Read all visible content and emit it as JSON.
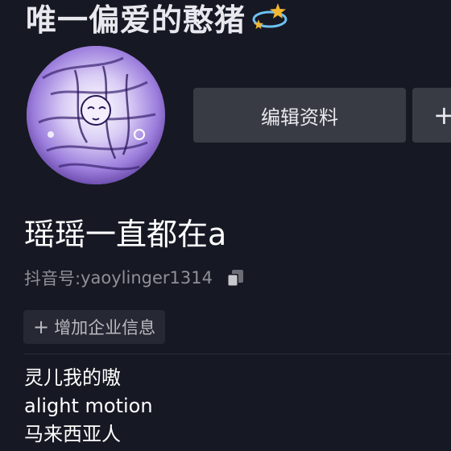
{
  "profile": {
    "top_name": "唯一偏爱的憨猪",
    "top_name_emoji": "sparkle-emoji",
    "nickname": "瑶瑶一直都在a",
    "douyin_id_label": "抖音号:",
    "douyin_id": "yaoylinger1314",
    "bio_lines": [
      "灵儿我的嗷",
      "alight motion",
      "马来西亚人"
    ]
  },
  "actions": {
    "edit_profile_label": "编辑资料",
    "add_friend_label": "+"
  },
  "business": {
    "add_info_label": "增加企业信息",
    "add_icon": "plus-icon"
  },
  "icons": {
    "copy": "copy-icon",
    "avatar": "avatar-image"
  },
  "colors": {
    "background": "#161823",
    "button_bg": "#393b44",
    "secondary_text": "#8f9097"
  }
}
